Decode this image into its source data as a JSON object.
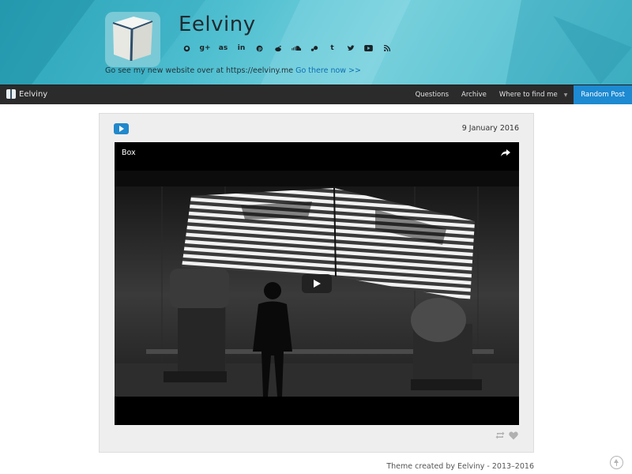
{
  "header": {
    "site_title": "Eelviny",
    "announcement_text": "Go see my new website over at https://eelviny.me",
    "announcement_link": "Go there now >>",
    "social_icons": [
      "github-icon",
      "google-plus-icon",
      "lastfm-icon",
      "linkedin-icon",
      "pinterest-icon",
      "reddit-icon",
      "soundcloud-icon",
      "steam-icon",
      "tumblr-icon",
      "twitter-icon",
      "youtube-icon",
      "rss-icon"
    ],
    "background_color": "#4fbfd0"
  },
  "navbar": {
    "brand": "Eelviny",
    "links": [
      "Questions",
      "Archive",
      "Where to find me"
    ],
    "random_post": "Random Post",
    "accent_color": "#1d8ad1"
  },
  "post": {
    "type": "video",
    "date": "9 January 2016",
    "video_title": "Box"
  },
  "footer": {
    "credit": "Theme created by Eelviny - 2013–2016"
  }
}
